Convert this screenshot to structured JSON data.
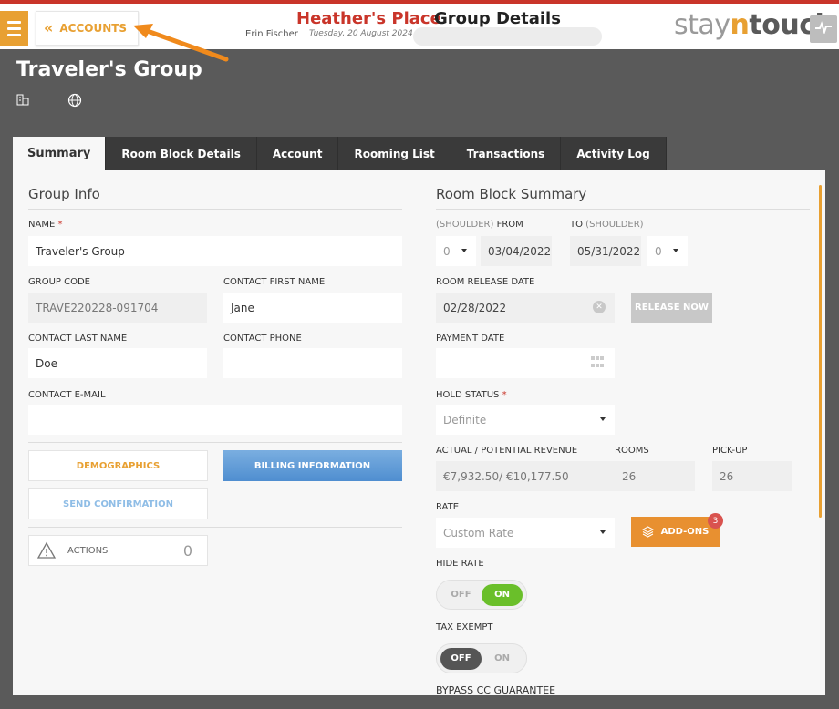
{
  "header": {
    "menu_icon": "hamburger-icon",
    "back_label": "ACCOUNTS",
    "back_icon": "double-chevron-left-icon",
    "hotel_name": "Heather's Place",
    "page_title": "Group Details",
    "user_name": "Erin Fischer",
    "date": "Tuesday, 20 August 2024",
    "logo_pre": "stay",
    "logo_n": "n",
    "logo_post": "touch"
  },
  "group": {
    "title": "Traveler's Group",
    "icons": [
      "building-icon",
      "globe-icon"
    ]
  },
  "tabs": [
    {
      "label": "Summary",
      "active": true
    },
    {
      "label": "Room Block Details"
    },
    {
      "label": "Account"
    },
    {
      "label": "Rooming List"
    },
    {
      "label": "Transactions"
    },
    {
      "label": "Activity Log"
    }
  ],
  "group_info": {
    "title": "Group Info",
    "name_label": "NAME",
    "required_mark": "*",
    "name_value": "Traveler's Group",
    "group_code_label": "GROUP CODE",
    "group_code_value": "TRAVE220228-091704",
    "contact_first_label": "CONTACT FIRST NAME",
    "contact_first_value": "Jane",
    "contact_last_label": "CONTACT LAST NAME",
    "contact_last_value": "Doe",
    "contact_phone_label": "CONTACT PHONE",
    "contact_phone_value": "",
    "contact_email_label": "CONTACT E-MAIL",
    "contact_email_value": "",
    "demographics_label": "DEMOGRAPHICS",
    "billing_label": "BILLING INFORMATION",
    "send_confirmation_label": "SEND CONFIRMATION",
    "actions_label": "ACTIONS",
    "actions_count": "0"
  },
  "room_block": {
    "title": "Room Block Summary",
    "from_label_prefix": "(SHOULDER)",
    "from_label": "FROM",
    "to_label": "TO",
    "to_label_suffix": "(SHOULDER)",
    "shoulder_from_value": "0",
    "from_date": "03/04/2022",
    "to_date": "05/31/2022",
    "shoulder_to_value": "0",
    "release_date_label": "ROOM RELEASE DATE",
    "release_date_value": "02/28/2022",
    "release_now_label": "RELEASE NOW",
    "payment_date_label": "PAYMENT DATE",
    "payment_date_value": "",
    "hold_status_label": "HOLD STATUS",
    "hold_status_value": "Definite",
    "revenue_label": "ACTUAL / POTENTIAL REVENUE",
    "revenue_value": "€7,932.50/ €10,177.50",
    "rooms_label": "ROOMS",
    "rooms_value": "26",
    "pickup_label": "PICK-UP",
    "pickup_value": "26",
    "rate_label": "RATE",
    "rate_value": "Custom Rate",
    "addons_label": "ADD-ONS",
    "addons_badge": "3",
    "hide_rate_label": "HIDE RATE",
    "hide_rate_off": "OFF",
    "hide_rate_on": "ON",
    "hide_rate_state": "ON",
    "tax_exempt_label": "TAX EXEMPT",
    "tax_exempt_off": "OFF",
    "tax_exempt_on": "ON",
    "tax_exempt_state": "OFF",
    "bypass_label": "BYPASS CC GUARANTEE"
  },
  "colors": {
    "accent_orange": "#e8a032",
    "brand_red": "#c9352a",
    "toggle_green": "#6abf2a",
    "billing_blue": "#5b97d6",
    "background": "#5a5a5a"
  }
}
